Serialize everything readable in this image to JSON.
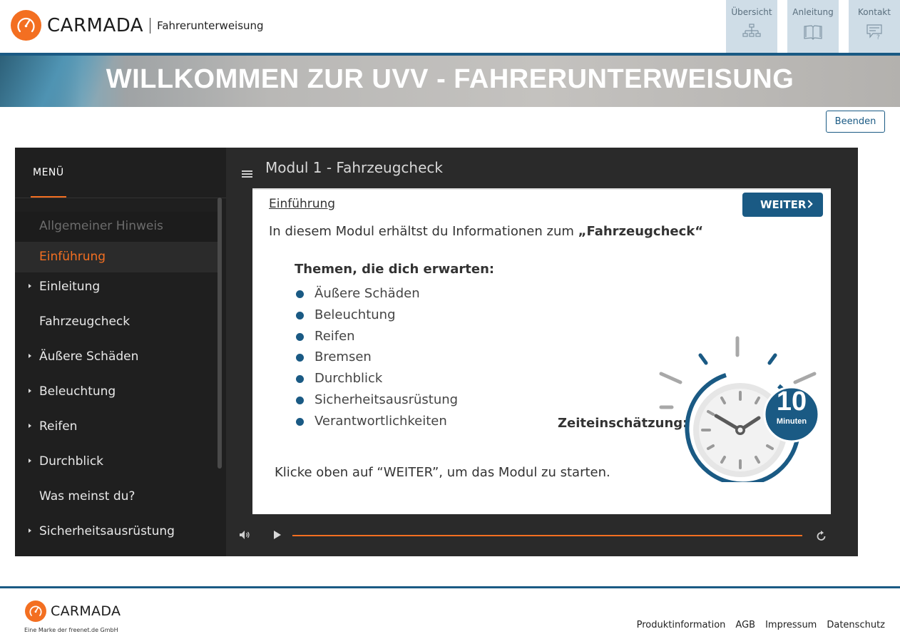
{
  "header": {
    "brand": "CARMADA",
    "subtitle": "Fahrerunterweisung",
    "nav": [
      {
        "label": "Übersicht",
        "icon": "sitemap-icon"
      },
      {
        "label": "Anleitung",
        "icon": "book-icon"
      },
      {
        "label": "Kontakt",
        "icon": "chat-question-icon"
      }
    ]
  },
  "banner": {
    "title": "WILLKOMMEN ZUR UVV - FAHRERUNTERWEISUNG"
  },
  "actions": {
    "end_label": "Beenden"
  },
  "sidebar": {
    "title": "MENÜ",
    "items": [
      {
        "label": "Allgemeiner Hinweis",
        "state": "visited"
      },
      {
        "label": "Einführung",
        "state": "active"
      },
      {
        "label": "Einleitung",
        "expandable": true
      },
      {
        "label": "Fahrzeugcheck"
      },
      {
        "label": "Äußere Schäden",
        "expandable": true
      },
      {
        "label": "Beleuchtung",
        "expandable": true
      },
      {
        "label": "Reifen",
        "expandable": true
      },
      {
        "label": "Durchblick",
        "expandable": true
      },
      {
        "label": "Was meinst du?"
      },
      {
        "label": "Sicherheitsausrüstung",
        "expandable": true
      }
    ]
  },
  "module": {
    "title": "Modul 1 - Fahrzeugcheck",
    "slide": {
      "heading": "Einführung",
      "next_label": "WEITER",
      "intro_prefix": "In diesem Modul erhältst du Informationen zum ",
      "intro_bold": "„Fahrzeugcheck“",
      "themes_heading": "Themen, die dich erwarten:",
      "topics": [
        "Äußere Schäden",
        "Beleuchtung",
        "Reifen",
        "Bremsen",
        "Durchblick",
        "Sicherheitsausrüstung",
        "Verantwortlichkeiten"
      ],
      "time_label": "Zeiteinschätzung:",
      "time_value": "10",
      "time_unit": "Minuten",
      "hint": "Klicke oben auf “WEITER”, um das Modul zu starten."
    }
  },
  "footer": {
    "brand": "CARMADA",
    "tagline": "Eine Marke der freenet.de GmbH",
    "links": [
      "Produktinformation",
      "AGB",
      "Impressum",
      "Datenschutz"
    ]
  },
  "colors": {
    "accent": "#f36f21",
    "primary": "#1a5a84",
    "nav_bg": "#cfdde7",
    "player_bg": "#2a2a2a"
  }
}
